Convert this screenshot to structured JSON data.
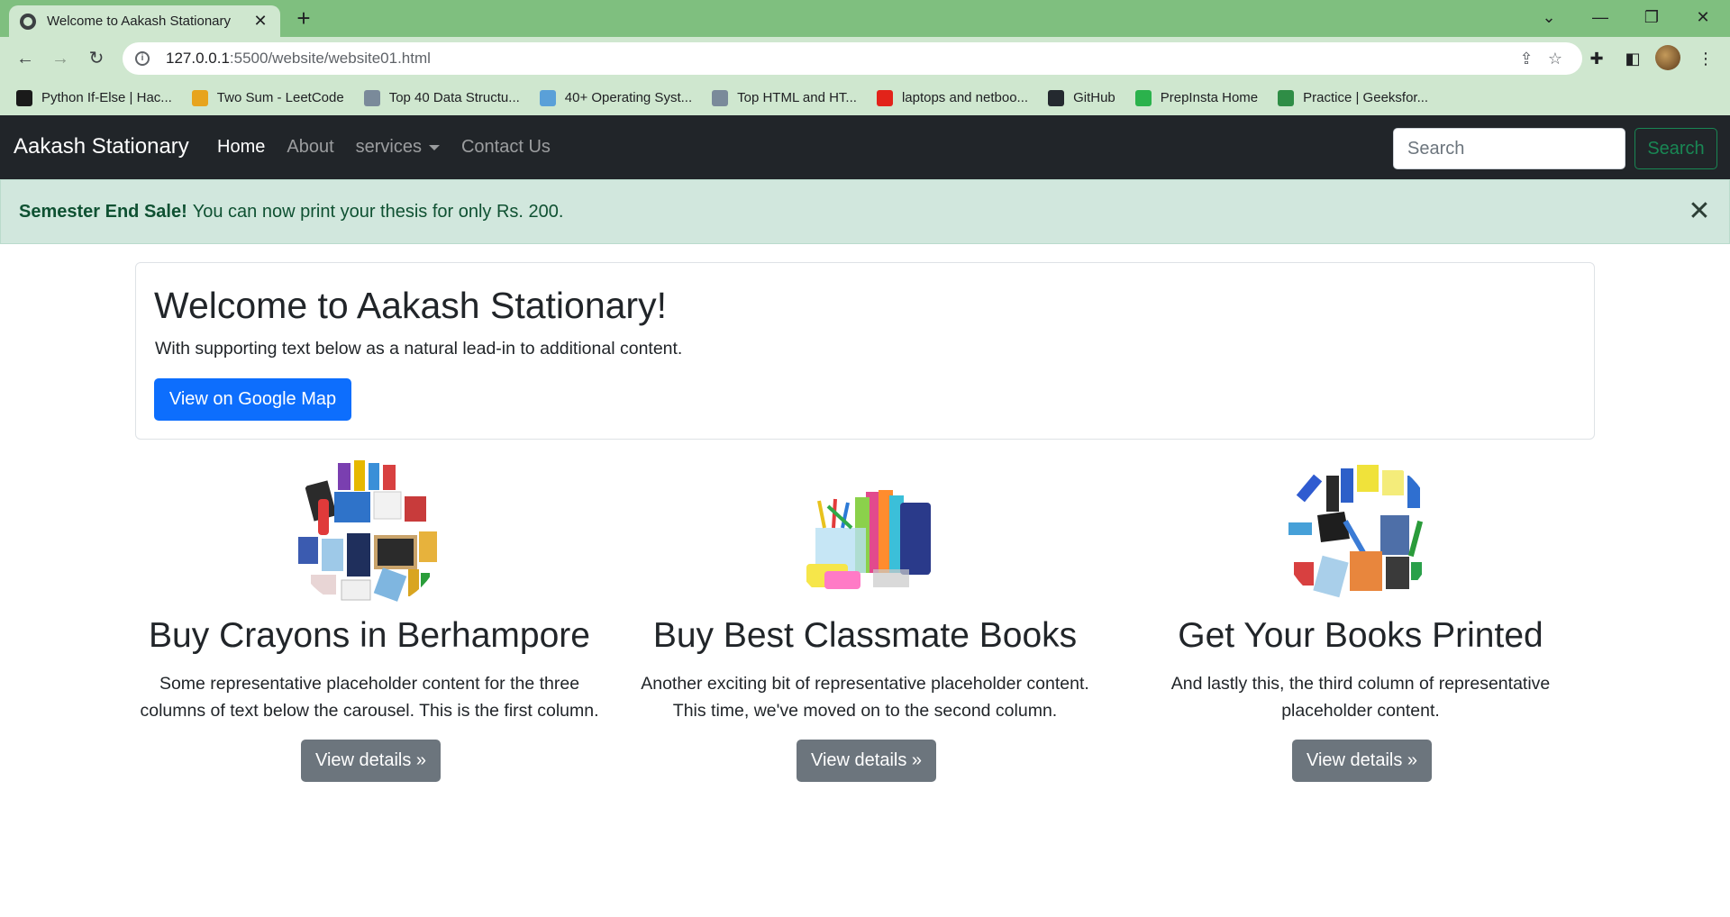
{
  "browser": {
    "tab_title": "Welcome to Aakash Stationary",
    "url_host": "127.0.0.1",
    "url_path": ":5500/website/website01.html",
    "bookmarks": [
      {
        "label": "Python If-Else | Hac...",
        "icon": "hackerrank-icon",
        "color": "#1a1a1a"
      },
      {
        "label": "Two Sum - LeetCode",
        "icon": "leetcode-icon",
        "color": "#e7a41e"
      },
      {
        "label": "Top 40 Data Structu...",
        "icon": "interviewbit-icon",
        "color": "#7a8a9a"
      },
      {
        "label": "40+ Operating Syst...",
        "icon": "interviewbit-icon",
        "color": "#5aa0d8"
      },
      {
        "label": "Top HTML and HT...",
        "icon": "interviewbit-icon",
        "color": "#7a8a9a"
      },
      {
        "label": "laptops and netboo...",
        "icon": "lenovo-icon",
        "color": "#e2231a"
      },
      {
        "label": "GitHub",
        "icon": "github-icon",
        "color": "#24292f"
      },
      {
        "label": "PrepInsta Home",
        "icon": "prepinsta-icon",
        "color": "#2bb24c"
      },
      {
        "label": "Practice | Geeksfor...",
        "icon": "geeksforgeeks-icon",
        "color": "#2f8d46"
      }
    ]
  },
  "navbar": {
    "brand": "Aakash Stationary",
    "links": [
      "Home",
      "About",
      "services",
      "Contact Us"
    ],
    "search_placeholder": "Search",
    "search_button": "Search"
  },
  "alert": {
    "strong": "Semester End Sale!",
    "text": "You can now print your thesis for only Rs. 200."
  },
  "hero": {
    "title": "Welcome to Aakash Stationary!",
    "text": "With supporting text below as a natural lead-in to additional content.",
    "button": "View on Google Map"
  },
  "columns": [
    {
      "title": "Buy Crayons in Berhampore",
      "text_line1": "Some representative placeholder content for the three",
      "text_line2": "columns of text below the carousel. This is the first column.",
      "button": "View details »"
    },
    {
      "title": "Buy Best Classmate Books",
      "text_line1": "Another exciting bit of representative placeholder content.",
      "text_line2": "This time, we've moved on to the second column.",
      "button": "View details »"
    },
    {
      "title": "Get Your Books Printed",
      "text_line1": "And lastly this, the third column of representative",
      "text_line2": "placeholder content.",
      "button": "View details »"
    }
  ],
  "colors": {
    "navbar_bg": "#212529",
    "primary": "#0d6efd",
    "secondary": "#6c757d",
    "success": "#198754",
    "alert_bg": "#d1e7dd",
    "chrome_accent": "#7fbf7f"
  }
}
